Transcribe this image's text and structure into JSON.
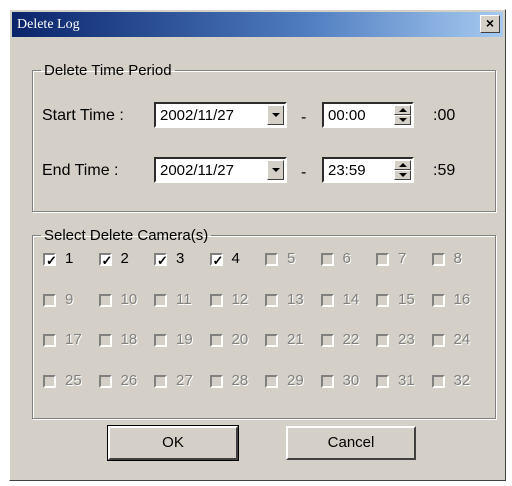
{
  "window": {
    "title": "Delete Log",
    "close_glyph": "×"
  },
  "time_group": {
    "legend": "Delete Time Period",
    "start": {
      "label": "Start Time :",
      "date": "2002/11/27",
      "dash": "-",
      "time": "00:00",
      "seconds": ":00"
    },
    "end": {
      "label": "End Time :",
      "date": "2002/11/27",
      "dash": "-",
      "time": "23:59",
      "seconds": ":59"
    }
  },
  "camera_group": {
    "legend": "Select Delete Camera(s)",
    "cameras": [
      {
        "num": "1",
        "checked": true,
        "enabled": true
      },
      {
        "num": "2",
        "checked": true,
        "enabled": true
      },
      {
        "num": "3",
        "checked": true,
        "enabled": true
      },
      {
        "num": "4",
        "checked": true,
        "enabled": true
      },
      {
        "num": "5",
        "checked": false,
        "enabled": false
      },
      {
        "num": "6",
        "checked": false,
        "enabled": false
      },
      {
        "num": "7",
        "checked": false,
        "enabled": false
      },
      {
        "num": "8",
        "checked": false,
        "enabled": false
      },
      {
        "num": "9",
        "checked": false,
        "enabled": false
      },
      {
        "num": "10",
        "checked": false,
        "enabled": false
      },
      {
        "num": "11",
        "checked": false,
        "enabled": false
      },
      {
        "num": "12",
        "checked": false,
        "enabled": false
      },
      {
        "num": "13",
        "checked": false,
        "enabled": false
      },
      {
        "num": "14",
        "checked": false,
        "enabled": false
      },
      {
        "num": "15",
        "checked": false,
        "enabled": false
      },
      {
        "num": "16",
        "checked": false,
        "enabled": false
      },
      {
        "num": "17",
        "checked": false,
        "enabled": false
      },
      {
        "num": "18",
        "checked": false,
        "enabled": false
      },
      {
        "num": "19",
        "checked": false,
        "enabled": false
      },
      {
        "num": "20",
        "checked": false,
        "enabled": false
      },
      {
        "num": "21",
        "checked": false,
        "enabled": false
      },
      {
        "num": "22",
        "checked": false,
        "enabled": false
      },
      {
        "num": "23",
        "checked": false,
        "enabled": false
      },
      {
        "num": "24",
        "checked": false,
        "enabled": false
      },
      {
        "num": "25",
        "checked": false,
        "enabled": false
      },
      {
        "num": "26",
        "checked": false,
        "enabled": false
      },
      {
        "num": "27",
        "checked": false,
        "enabled": false
      },
      {
        "num": "28",
        "checked": false,
        "enabled": false
      },
      {
        "num": "29",
        "checked": false,
        "enabled": false
      },
      {
        "num": "30",
        "checked": false,
        "enabled": false
      },
      {
        "num": "31",
        "checked": false,
        "enabled": false
      },
      {
        "num": "32",
        "checked": false,
        "enabled": false
      }
    ]
  },
  "buttons": {
    "ok": "OK",
    "cancel": "Cancel"
  },
  "icons": {
    "dropdown": "chevron-down-icon",
    "spin_up": "spin-up-icon",
    "spin_down": "spin-down-icon",
    "close": "close-icon"
  }
}
